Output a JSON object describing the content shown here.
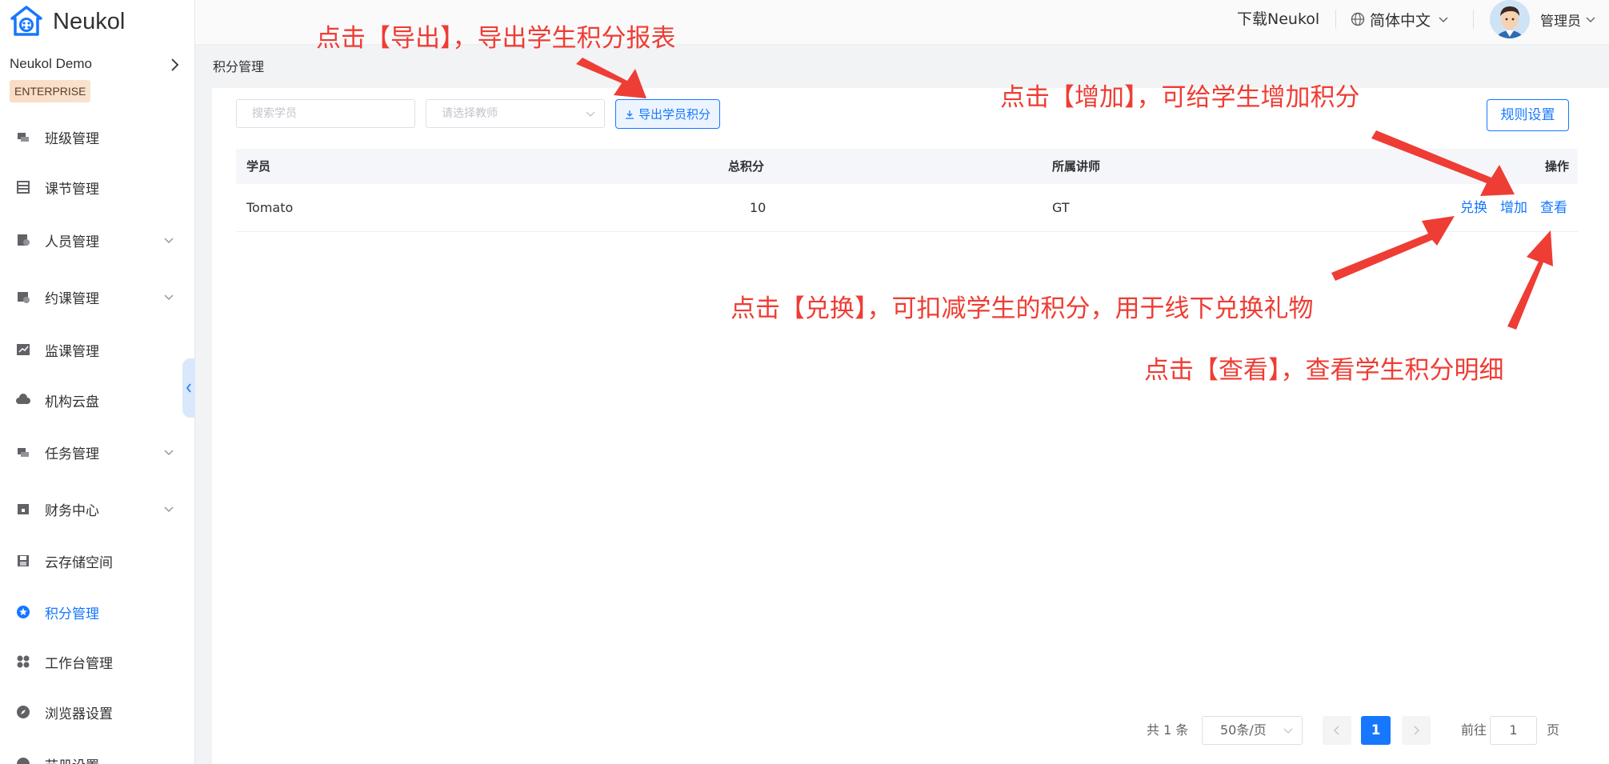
{
  "app": {
    "logo_text": "Neukol"
  },
  "sidebar": {
    "org_name": "Neukol Demo",
    "badge": "ENTERPRISE",
    "items": [
      {
        "label": "班级管理",
        "icon": "class-icon"
      },
      {
        "label": "课节管理",
        "icon": "lesson-icon"
      },
      {
        "label": "人员管理",
        "icon": "people-icon"
      },
      {
        "label": "约课管理",
        "icon": "booking-icon"
      },
      {
        "label": "监课管理",
        "icon": "monitor-icon"
      },
      {
        "label": "机构云盘",
        "icon": "cloud-icon"
      },
      {
        "label": "任务管理",
        "icon": "task-icon"
      },
      {
        "label": "财务中心",
        "icon": "finance-icon"
      },
      {
        "label": "云存储空间",
        "icon": "storage-icon"
      },
      {
        "label": "积分管理",
        "icon": "points-icon"
      },
      {
        "label": "工作台管理",
        "icon": "workbench-icon"
      },
      {
        "label": "浏览器设置",
        "icon": "browser-icon"
      },
      {
        "label": "节册设置",
        "icon": "settings-icon"
      }
    ],
    "active": "积分管理"
  },
  "header": {
    "download": "下载Neukol",
    "language": "简体中文",
    "user": "管理员"
  },
  "page": {
    "breadcrumb": "积分管理",
    "search_placeholder": "搜索学员",
    "teacher_placeholder": "请选择教师",
    "export_label": "导出学员积分",
    "rules_label": "规则设置"
  },
  "table": {
    "columns": [
      "学员",
      "总积分",
      "所属讲师",
      "操作"
    ],
    "rows": [
      {
        "student": "Tomato",
        "points": "10",
        "teacher": "GT",
        "actions": [
          "兑换",
          "增加",
          "查看"
        ]
      }
    ]
  },
  "pagination": {
    "total": "共 1 条",
    "page_size": "50条/页",
    "current": "1",
    "goto_label": "前往",
    "goto_value": "1",
    "goto_unit": "页"
  },
  "annotations": {
    "export": "点击【导出】，导出学生积分报表",
    "add": "点击【增加】，可给学生增加积分",
    "redeem": "点击【兑换】，可扣减学生的积分，用于线下兑换礼物",
    "view": "点击【查看】，查看学生积分明细"
  },
  "colors": {
    "accent": "#1677ff",
    "annotation": "#ee3d34"
  }
}
